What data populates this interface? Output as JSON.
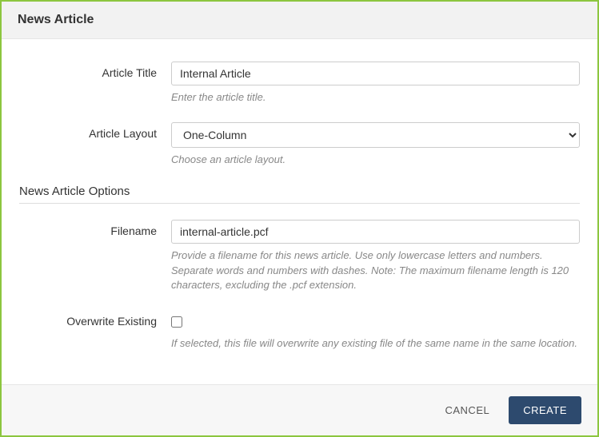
{
  "header": {
    "title": "News Article"
  },
  "fields": {
    "article_title": {
      "label": "Article Title",
      "value": "Internal Article",
      "help": "Enter the article title."
    },
    "article_layout": {
      "label": "Article Layout",
      "value": "One-Column",
      "help": "Choose an article layout."
    },
    "section_heading": "News Article Options",
    "filename": {
      "label": "Filename",
      "value": "internal-article.pcf",
      "help": "Provide a filename for this news article. Use only lowercase letters and numbers. Separate words and numbers with dashes. Note: The maximum filename length is 120 characters, excluding the .pcf extension."
    },
    "overwrite": {
      "label": "Overwrite Existing",
      "help": "If selected, this file will overwrite any existing file of the same name in the same location."
    }
  },
  "footer": {
    "cancel": "CANCEL",
    "create": "CREATE"
  }
}
